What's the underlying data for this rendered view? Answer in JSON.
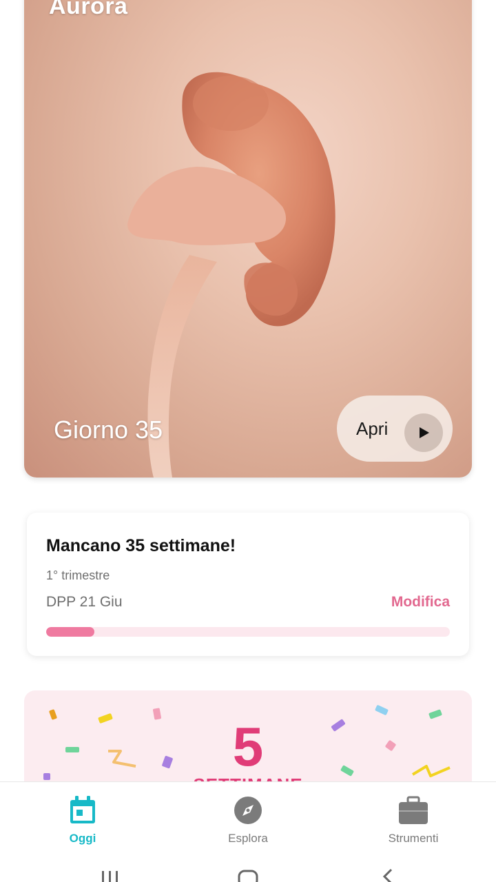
{
  "hero": {
    "title": "Aurora",
    "day_label": "Giorno 35",
    "open_label": "Apri"
  },
  "countdown": {
    "title": "Mancano 35 settimane!",
    "trimester": "1° trimestre",
    "due_date": "DPP 21 Giu",
    "edit_label": "Modifica",
    "progress": 0.12
  },
  "weeks": {
    "number": "5",
    "word": "SETTIMANE"
  },
  "nav": {
    "items": [
      {
        "label": "Oggi",
        "icon": "calendar-icon",
        "active": true
      },
      {
        "label": "Esplora",
        "icon": "compass-icon",
        "active": false
      },
      {
        "label": "Strumenti",
        "icon": "toolbox-icon",
        "active": false
      }
    ]
  },
  "colors": {
    "accent_teal": "#17b9c7",
    "accent_pink": "#e03c77",
    "link_pink": "#e2688f",
    "progress_track": "#fce8ee",
    "progress_fill": "#ef7aa0"
  }
}
